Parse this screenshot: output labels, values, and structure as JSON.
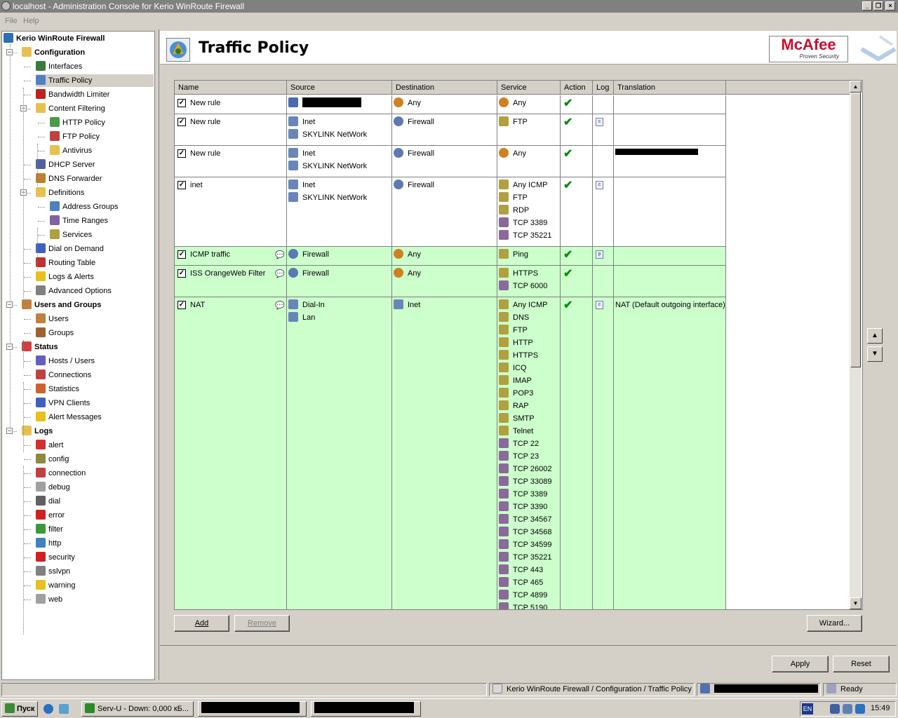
{
  "window": {
    "title": "localhost - Administration Console for Kerio WinRoute Firewall"
  },
  "menu": [
    "File",
    "Help"
  ],
  "tree": [
    {
      "label": "Kerio WinRoute Firewall",
      "level": 0,
      "bold": true,
      "icon": "kerio-icon",
      "color": "#2a6fb5"
    },
    {
      "label": "Configuration",
      "level": 1,
      "bold": true,
      "icon": "folder-open-icon",
      "color": "#e8c050",
      "exp": "-"
    },
    {
      "label": "Interfaces",
      "level": 2,
      "icon": "network-card-icon",
      "color": "#3a7a3a"
    },
    {
      "label": "Traffic Policy",
      "level": 2,
      "icon": "traffic-policy-icon",
      "color": "#5080c0",
      "sel": true
    },
    {
      "label": "Bandwidth Limiter",
      "level": 2,
      "icon": "bandwidth-limiter-icon",
      "color": "#c02020"
    },
    {
      "label": "Content Filtering",
      "level": 2,
      "icon": "folder-open-icon",
      "color": "#e8c050",
      "exp": "-"
    },
    {
      "label": "HTTP Policy",
      "level": 3,
      "icon": "http-policy-icon",
      "color": "#4a9a4a"
    },
    {
      "label": "FTP Policy",
      "level": 3,
      "icon": "ftp-policy-icon",
      "color": "#c04040"
    },
    {
      "label": "Antivirus",
      "level": 3,
      "icon": "antivirus-icon",
      "color": "#e8c050"
    },
    {
      "label": "DHCP Server",
      "level": 2,
      "icon": "dhcp-icon",
      "color": "#5060a0"
    },
    {
      "label": "DNS Forwarder",
      "level": 2,
      "icon": "dns-icon",
      "color": "#c08030"
    },
    {
      "label": "Definitions",
      "level": 2,
      "icon": "folder-open-icon",
      "color": "#e8c050",
      "exp": "-"
    },
    {
      "label": "Address Groups",
      "level": 3,
      "icon": "address-groups-icon",
      "color": "#5080c0"
    },
    {
      "label": "Time Ranges",
      "level": 3,
      "icon": "time-ranges-icon",
      "color": "#8060a0"
    },
    {
      "label": "Services",
      "level": 3,
      "icon": "services-icon",
      "color": "#b0a040"
    },
    {
      "label": "Dial on Demand",
      "level": 2,
      "icon": "dial-icon",
      "color": "#4060c0"
    },
    {
      "label": "Routing Table",
      "level": 2,
      "icon": "routing-icon",
      "color": "#c03030"
    },
    {
      "label": "Logs & Alerts",
      "level": 2,
      "icon": "warning-icon",
      "color": "#e8c020"
    },
    {
      "label": "Advanced Options",
      "level": 2,
      "icon": "advanced-options-icon",
      "color": "#808080"
    },
    {
      "label": "Users and Groups",
      "level": 1,
      "bold": true,
      "icon": "users-groups-icon",
      "color": "#c08040",
      "exp": "-"
    },
    {
      "label": "Users",
      "level": 2,
      "icon": "user-icon",
      "color": "#c08040"
    },
    {
      "label": "Groups",
      "level": 2,
      "icon": "group-icon",
      "color": "#a06030"
    },
    {
      "label": "Status",
      "level": 1,
      "bold": true,
      "icon": "status-icon",
      "color": "#d04040",
      "exp": "-"
    },
    {
      "label": "Hosts / Users",
      "level": 2,
      "icon": "hosts-icon",
      "color": "#6060c0"
    },
    {
      "label": "Connections",
      "level": 2,
      "icon": "connections-icon",
      "color": "#c04040"
    },
    {
      "label": "Statistics",
      "level": 2,
      "icon": "statistics-icon",
      "color": "#d06030"
    },
    {
      "label": "VPN Clients",
      "level": 2,
      "icon": "vpn-icon",
      "color": "#4060c0"
    },
    {
      "label": "Alert Messages",
      "level": 2,
      "icon": "warning-icon",
      "color": "#e8c020"
    },
    {
      "label": "Logs",
      "level": 1,
      "bold": true,
      "icon": "folder-open-icon",
      "color": "#e8c050",
      "exp": "-"
    },
    {
      "label": "alert",
      "level": 2,
      "icon": "alert-log-icon",
      "color": "#d03030"
    },
    {
      "label": "config",
      "level": 2,
      "icon": "config-log-icon",
      "color": "#8a8a40"
    },
    {
      "label": "connection",
      "level": 2,
      "icon": "connection-log-icon",
      "color": "#c04040"
    },
    {
      "label": "debug",
      "level": 2,
      "icon": "debug-log-icon",
      "color": "#a0a0a0"
    },
    {
      "label": "dial",
      "level": 2,
      "icon": "dial-log-icon",
      "color": "#606060"
    },
    {
      "label": "error",
      "level": 2,
      "icon": "error-log-icon",
      "color": "#d02020"
    },
    {
      "label": "filter",
      "level": 2,
      "icon": "filter-log-icon",
      "color": "#3a9a3a"
    },
    {
      "label": "http",
      "level": 2,
      "icon": "http-log-icon",
      "color": "#4080c0"
    },
    {
      "label": "security",
      "level": 2,
      "icon": "security-log-icon",
      "color": "#d02020"
    },
    {
      "label": "sslvpn",
      "level": 2,
      "icon": "sslvpn-log-icon",
      "color": "#808080"
    },
    {
      "label": "warning",
      "level": 2,
      "icon": "warning-icon",
      "color": "#e8c020"
    },
    {
      "label": "web",
      "level": 2,
      "icon": "web-log-icon",
      "color": "#a0a0a0"
    }
  ],
  "page": {
    "title": "Traffic Policy"
  },
  "logo": {
    "brand": "McAfee",
    "tagline": "Proven Security"
  },
  "table": {
    "columns": [
      "Name",
      "Source",
      "Destination",
      "Service",
      "Action",
      "Log",
      "Translation"
    ],
    "rows": [
      {
        "name": "New rule",
        "checked": true,
        "green": false,
        "comment": false,
        "source": [
          {
            "text": "",
            "icon": "host-icon",
            "redacted": true
          }
        ],
        "destination": [
          {
            "text": "Any",
            "icon": "any-icon"
          }
        ],
        "service": [
          {
            "text": "Any",
            "icon": "any-icon"
          }
        ],
        "action": "✔",
        "log": "",
        "translation": ""
      },
      {
        "name": "New rule",
        "checked": true,
        "green": false,
        "comment": false,
        "source": [
          {
            "text": "Inet",
            "icon": "network-icon"
          },
          {
            "text": "SKYLINK NetWork",
            "icon": "network-icon"
          }
        ],
        "destination": [
          {
            "text": "Firewall",
            "icon": "firewall-icon"
          }
        ],
        "service": [
          {
            "text": "FTP",
            "icon": "service-icon"
          }
        ],
        "action": "✔",
        "log": "c",
        "translation": ""
      },
      {
        "name": "New rule",
        "checked": true,
        "green": false,
        "comment": false,
        "source": [
          {
            "text": "Inet",
            "icon": "network-icon"
          },
          {
            "text": "SKYLINK NetWork",
            "icon": "network-icon"
          }
        ],
        "destination": [
          {
            "text": "Firewall",
            "icon": "firewall-icon"
          }
        ],
        "service": [
          {
            "text": "Any",
            "icon": "any-icon"
          }
        ],
        "action": "✔",
        "log": "",
        "translation": "",
        "translation_redacted": true
      },
      {
        "name": "inet",
        "checked": true,
        "green": false,
        "comment": false,
        "source": [
          {
            "text": "Inet",
            "icon": "network-icon"
          },
          {
            "text": "SKYLINK NetWork",
            "icon": "network-icon"
          }
        ],
        "destination": [
          {
            "text": "Firewall",
            "icon": "firewall-icon"
          }
        ],
        "service": [
          {
            "text": "Any ICMP",
            "icon": "service-icon"
          },
          {
            "text": "FTP",
            "icon": "service-icon"
          },
          {
            "text": "RDP",
            "icon": "service-icon"
          },
          {
            "text": "TCP 3389",
            "icon": "port-icon"
          },
          {
            "text": "TCP 35221",
            "icon": "port-icon"
          }
        ],
        "action": "✔",
        "log": "c",
        "translation": ""
      },
      {
        "name": "ICMP traffic",
        "checked": true,
        "green": true,
        "comment": true,
        "source": [
          {
            "text": "Firewall",
            "icon": "firewall-icon"
          }
        ],
        "destination": [
          {
            "text": "Any",
            "icon": "any-icon"
          }
        ],
        "service": [
          {
            "text": "Ping",
            "icon": "service-icon"
          }
        ],
        "action": "✔",
        "log": "p",
        "translation": ""
      },
      {
        "name": "ISS OrangeWeb Filter",
        "checked": true,
        "green": true,
        "comment": true,
        "source": [
          {
            "text": "Firewall",
            "icon": "firewall-icon"
          }
        ],
        "destination": [
          {
            "text": "Any",
            "icon": "any-icon"
          }
        ],
        "service": [
          {
            "text": "HTTPS",
            "icon": "service-icon"
          },
          {
            "text": "TCP 6000",
            "icon": "port-icon"
          }
        ],
        "action": "✔",
        "log": "",
        "translation": ""
      },
      {
        "name": "NAT",
        "checked": true,
        "green": true,
        "comment": true,
        "source": [
          {
            "text": "Dial-In",
            "icon": "network-icon"
          },
          {
            "text": "Lan",
            "icon": "network-icon"
          }
        ],
        "destination": [
          {
            "text": "Inet",
            "icon": "network-icon"
          }
        ],
        "service": [
          {
            "text": "Any ICMP",
            "icon": "service-icon"
          },
          {
            "text": "DNS",
            "icon": "service-icon"
          },
          {
            "text": "FTP",
            "icon": "service-icon"
          },
          {
            "text": "HTTP",
            "icon": "service-icon"
          },
          {
            "text": "HTTPS",
            "icon": "service-icon"
          },
          {
            "text": "ICQ",
            "icon": "service-icon"
          },
          {
            "text": "IMAP",
            "icon": "service-icon"
          },
          {
            "text": "POP3",
            "icon": "service-icon"
          },
          {
            "text": "RAP",
            "icon": "service-icon"
          },
          {
            "text": "SMTP",
            "icon": "service-icon"
          },
          {
            "text": "Telnet",
            "icon": "service-icon"
          },
          {
            "text": "TCP 22",
            "icon": "port-icon"
          },
          {
            "text": "TCP 23",
            "icon": "port-icon"
          },
          {
            "text": "TCP 26002",
            "icon": "port-icon"
          },
          {
            "text": "TCP 33089",
            "icon": "port-icon"
          },
          {
            "text": "TCP 3389",
            "icon": "port-icon"
          },
          {
            "text": "TCP 3390",
            "icon": "port-icon"
          },
          {
            "text": "TCP 34567",
            "icon": "port-icon"
          },
          {
            "text": "TCP 34568",
            "icon": "port-icon"
          },
          {
            "text": "TCP 34599",
            "icon": "port-icon"
          },
          {
            "text": "TCP 35221",
            "icon": "port-icon"
          },
          {
            "text": "TCP 443",
            "icon": "port-icon"
          },
          {
            "text": "TCP 465",
            "icon": "port-icon"
          },
          {
            "text": "TCP 4899",
            "icon": "port-icon"
          },
          {
            "text": "TCP 5190",
            "icon": "port-icon"
          }
        ],
        "action": "✔",
        "log": "c",
        "translation": "NAT (Default outgoing interface)"
      }
    ]
  },
  "buttons": {
    "add": "Add",
    "remove": "Remove",
    "wizard": "Wizard...",
    "apply": "Apply",
    "reset": "Reset"
  },
  "statusbar": {
    "path": "Kerio WinRoute Firewall / Configuration / Traffic Policy",
    "ready": "Ready"
  },
  "taskbar": {
    "start": "Пуск",
    "task1": "Serv-U - Down: 0,000 кБ...",
    "lang": "EN",
    "clock": "15:49"
  },
  "colors": {
    "rule_green": "#ccffcc",
    "check_green": "#0a8a0a",
    "brand_red": "#c8102e"
  }
}
